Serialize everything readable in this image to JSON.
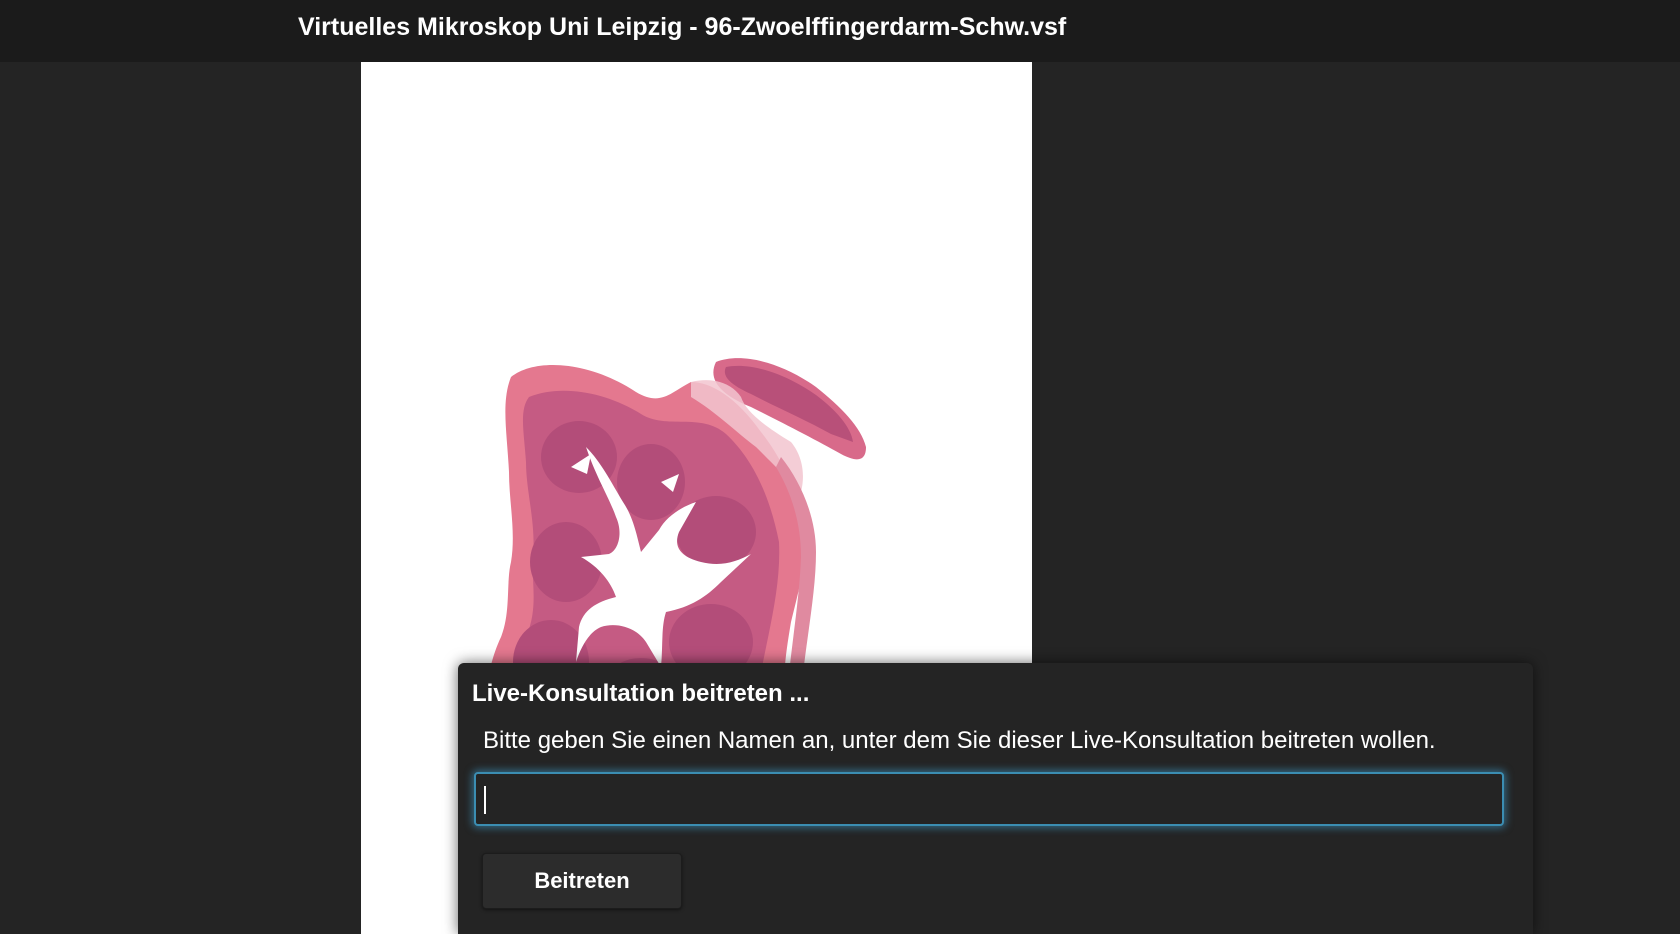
{
  "header": {
    "title": "Virtuelles Mikroskop Uni Leipzig - 96-Zwoelffingerdarm-Schw.vsf"
  },
  "viewer": {
    "image": "histology-slide-duodenum-cross-section",
    "background_color": "#ffffff"
  },
  "dialog": {
    "heading": "Live-Konsultation beitreten ...",
    "message": "Bitte geben Sie einen Namen an, unter dem Sie dieser Live-Konsultation beitreten wollen.",
    "name_input": {
      "value": "",
      "placeholder": ""
    },
    "join_button_label": "Beitreten",
    "accent_color": "#3b8db2"
  }
}
